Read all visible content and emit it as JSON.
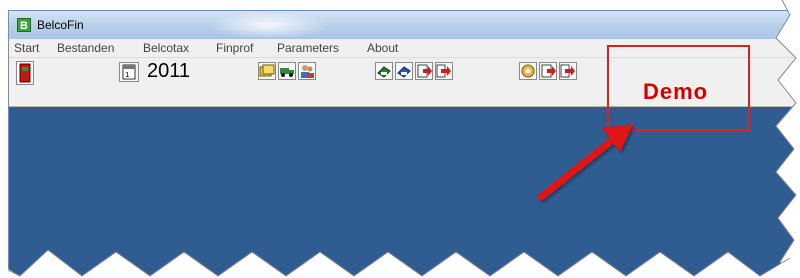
{
  "window": {
    "title": "BelcoFin",
    "app_icon_glyph": "B",
    "colors": {
      "client_area": "#2f5d91",
      "callout": "#e02020",
      "demo_text": "#d40000"
    }
  },
  "menu": {
    "items": [
      "Start",
      "Bestanden",
      "Belcotax",
      "Finprof",
      "Parameters",
      "About"
    ]
  },
  "toolbar": {
    "year": "2011",
    "demo_label": "Demo",
    "icons": [
      "exit-door-icon",
      "calendar-icon",
      "folders-icon",
      "truck-icon",
      "users-icon",
      "printer-green-icon",
      "printer-blue-icon",
      "export-arrow-icon",
      "document-arrow-icon",
      "gear-icon",
      "export-arrow-icon",
      "document-arrow-icon"
    ]
  },
  "annotation": {
    "type": "red-arrow-callout"
  }
}
